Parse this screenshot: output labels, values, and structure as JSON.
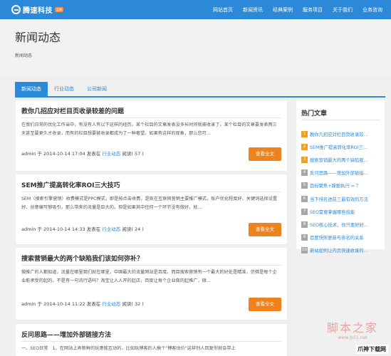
{
  "header": {
    "logo_text": "腾速科技",
    "logo_badge": "品牌",
    "nav": [
      "网站首页",
      "新闻资讯",
      "经典案例",
      "服务项目",
      "关于我们",
      "业务咨询"
    ]
  },
  "page": {
    "title": "新闻动态",
    "subtitle": "新闻动态"
  },
  "tabs": [
    "新闻动态",
    "行业动态",
    "公司新闻"
  ],
  "articles": [
    {
      "title": "教你几招应对栏目页收录较差的问题",
      "body": "在我们日常的优化工作当中，有没有人有以下这样的经历。某个栏目的文章发表没多长时间就被收录了，某个栏目的文章要发表两三天甚至要更久才收录，而有的栏目想要被收录都成为了一种奢望。如果有这样的现象，那么您可...",
      "author": "admin",
      "date_prefix": "于",
      "date": "2014-10-14 17:04",
      "posted_in": "发表在",
      "category": "行业动态",
      "reads": "阅读( 57 )",
      "button": "查看全文"
    },
    {
      "title": "SEM推广提高转化率ROI三大技巧",
      "body": "SEM（搜索引擎营销）收费模式是PPC模式，即是按点击收费，是现在互联网营销主要推广模式，账户优化程度好、关键词选择设置好、创意编写够吸引，那么带来的流量是巨大的。但是如果其中任何一个环节没有做好，就...",
      "author": "admin",
      "date_prefix": "于",
      "date": "2014-10-14 14:33",
      "posted_in": "发表在",
      "category": "行业动态",
      "reads": "阅读( 24 )",
      "button": "查看全文"
    },
    {
      "title": "搜索营销最大的两个缺陷我们该如何弥补？",
      "body": "做推广的人都知道，流量在哪里我们就在哪里，中国最大的流量网站是百度。而目搜索营销有一个最大的好处是精准，仿佛是每个企业能承受的起的，不是有一句流行语吗？淘宝让人人开的起店，百度让每个企业做的起推广，微...",
      "author": "admin",
      "date_prefix": "于",
      "date": "2014-10-14 11:22",
      "posted_in": "发表在",
      "category": "行业动态",
      "reads": "阅读( 32 )",
      "button": "查看全文"
    },
    {
      "title": "反问思路——增加外部链接方法",
      "body": "一、SEO日常　1、在网站上弄新鲜的玩意能互动的，比如玩博客的人搞个\"博客估价\"这样别人回复你就会带上",
      "author": "",
      "date_prefix": "",
      "date": "",
      "posted_in": "",
      "category": "",
      "reads": "",
      "button": ""
    }
  ],
  "sidebar": {
    "title": "热门文章",
    "items": [
      {
        "num": "1",
        "label": "教你几招应对栏目页收录较..."
      },
      {
        "num": "2",
        "label": "SEM推广提高转化率ROI三..."
      },
      {
        "num": "3",
        "label": "搜索营销最大的两个缺陷我..."
      },
      {
        "num": "4",
        "label": "反问思路——增加外部链接..."
      },
      {
        "num": "5",
        "label": "目标聚焦+躁狠执行 = ？"
      },
      {
        "num": "6",
        "label": "当下排名进前三最有效的方法"
      },
      {
        "num": "7",
        "label": "SEO需要掌握哪些技能"
      },
      {
        "num": "8",
        "label": "SEO核心技术，你只要好好..."
      },
      {
        "num": "9",
        "label": "百度快照更新与排名的关系"
      },
      {
        "num": "10",
        "label": "新站如何让内页快速收录的..."
      }
    ]
  },
  "watermark": {
    "main": "脚本之家",
    "url": "www.jb51.net",
    "corner": "爪神下载网"
  },
  "colors": {
    "primary": "#2c89d9",
    "button": "#f0821e",
    "hot_num": "#f0a020",
    "cold_num": "#a7a7a7"
  }
}
